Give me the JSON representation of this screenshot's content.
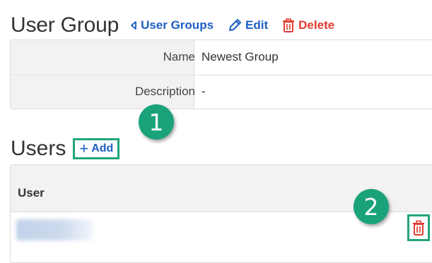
{
  "header": {
    "title": "User Group",
    "back_link": "User Groups",
    "edit_label": "Edit",
    "delete_label": "Delete"
  },
  "details": {
    "rows": [
      {
        "label": "Name",
        "value": "Newest Group"
      },
      {
        "label": "Description",
        "value": "-"
      }
    ]
  },
  "users": {
    "title": "Users",
    "add_label": "Add",
    "column_header": "User"
  },
  "markers": [
    "1",
    "2"
  ],
  "colors": {
    "link_blue": "#1d5fc4",
    "delete_red": "#e23b2e",
    "marker_green": "#1aa37a"
  }
}
